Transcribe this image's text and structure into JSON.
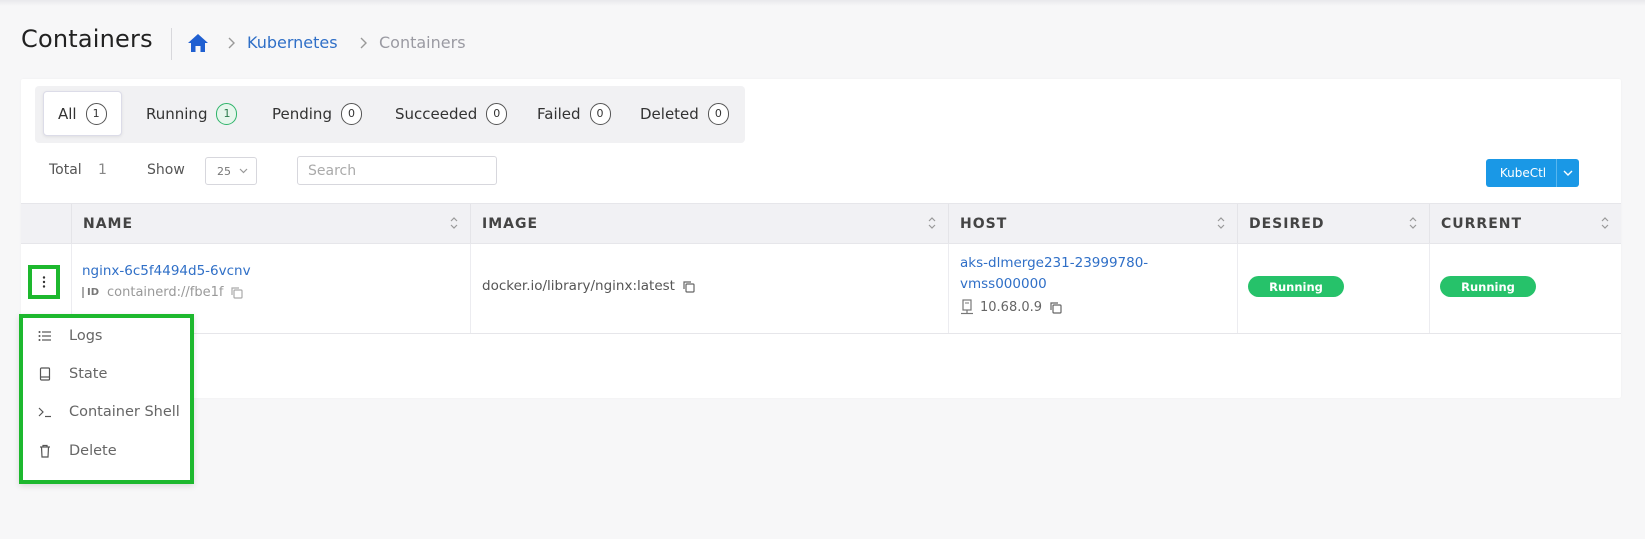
{
  "header": {
    "title": "Containers",
    "breadcrumb": {
      "kubernetes": "Kubernetes",
      "current": "Containers"
    }
  },
  "tabs": [
    {
      "label": "All",
      "count": "1"
    },
    {
      "label": "Running",
      "count": "1"
    },
    {
      "label": "Pending",
      "count": "0"
    },
    {
      "label": "Succeeded",
      "count": "0"
    },
    {
      "label": "Failed",
      "count": "0"
    },
    {
      "label": "Deleted",
      "count": "0"
    }
  ],
  "toolbar": {
    "total_label": "Total",
    "total_value": "1",
    "show_label": "Show",
    "show_value": "25",
    "search_placeholder": "Search",
    "kubectl_label": "KubeCtl"
  },
  "table": {
    "columns": [
      "NAME",
      "IMAGE",
      "HOST",
      "DESIRED",
      "CURRENT"
    ],
    "rows": [
      {
        "name": "nginx-6c5f4494d5-6vcnv",
        "id_badge": "ID",
        "id": "containerd://fbe1f",
        "image": "docker.io/library/nginx:latest",
        "host": "aks-dlmerge231-23999780-vmss000000",
        "host_ip": "10.68.0.9",
        "desired": "Running",
        "current": "Running"
      }
    ]
  },
  "menu": {
    "items": [
      {
        "label": "Logs",
        "icon": "list-icon"
      },
      {
        "label": "State",
        "icon": "book-icon"
      },
      {
        "label": "Container Shell",
        "icon": "terminal-icon"
      },
      {
        "label": "Delete",
        "icon": "trash-icon"
      }
    ]
  },
  "colors": {
    "accent": "#2f6fc7",
    "kubectl_button": "#1a98e6",
    "status_running": "#26c26a",
    "highlight": "#1db82e"
  }
}
